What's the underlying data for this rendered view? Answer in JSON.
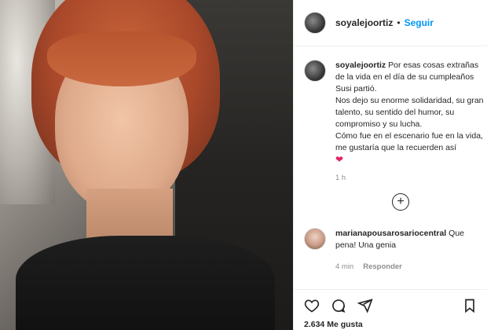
{
  "post": {
    "username": "soyalejoortiz",
    "follow_label": "Seguir",
    "separator": "•"
  },
  "caption": {
    "username": "soyalejoortiz",
    "line1": "Por esas cosas extrañas de la vida en el día de su cumpleaños Susi partió.",
    "line2": "Nos dejo su enorme solidaridad, su gran talento, su sentido del humor, su compromiso y su lucha.",
    "line3": "Cómo fue en el escenario fue en la vida, me gustaría que la recuerden así",
    "emoji": "❤",
    "time": "1 h"
  },
  "comment": {
    "username": "marianapousarosariocentral",
    "text": "Que pena! Una genia",
    "time": "4 min",
    "reply_label": "Responder"
  },
  "likes": "2.634 Me gusta",
  "icons": {
    "like": "heart-icon",
    "comment": "comment-icon",
    "share": "share-icon",
    "save": "bookmark-icon",
    "add": "add-comment-icon"
  }
}
